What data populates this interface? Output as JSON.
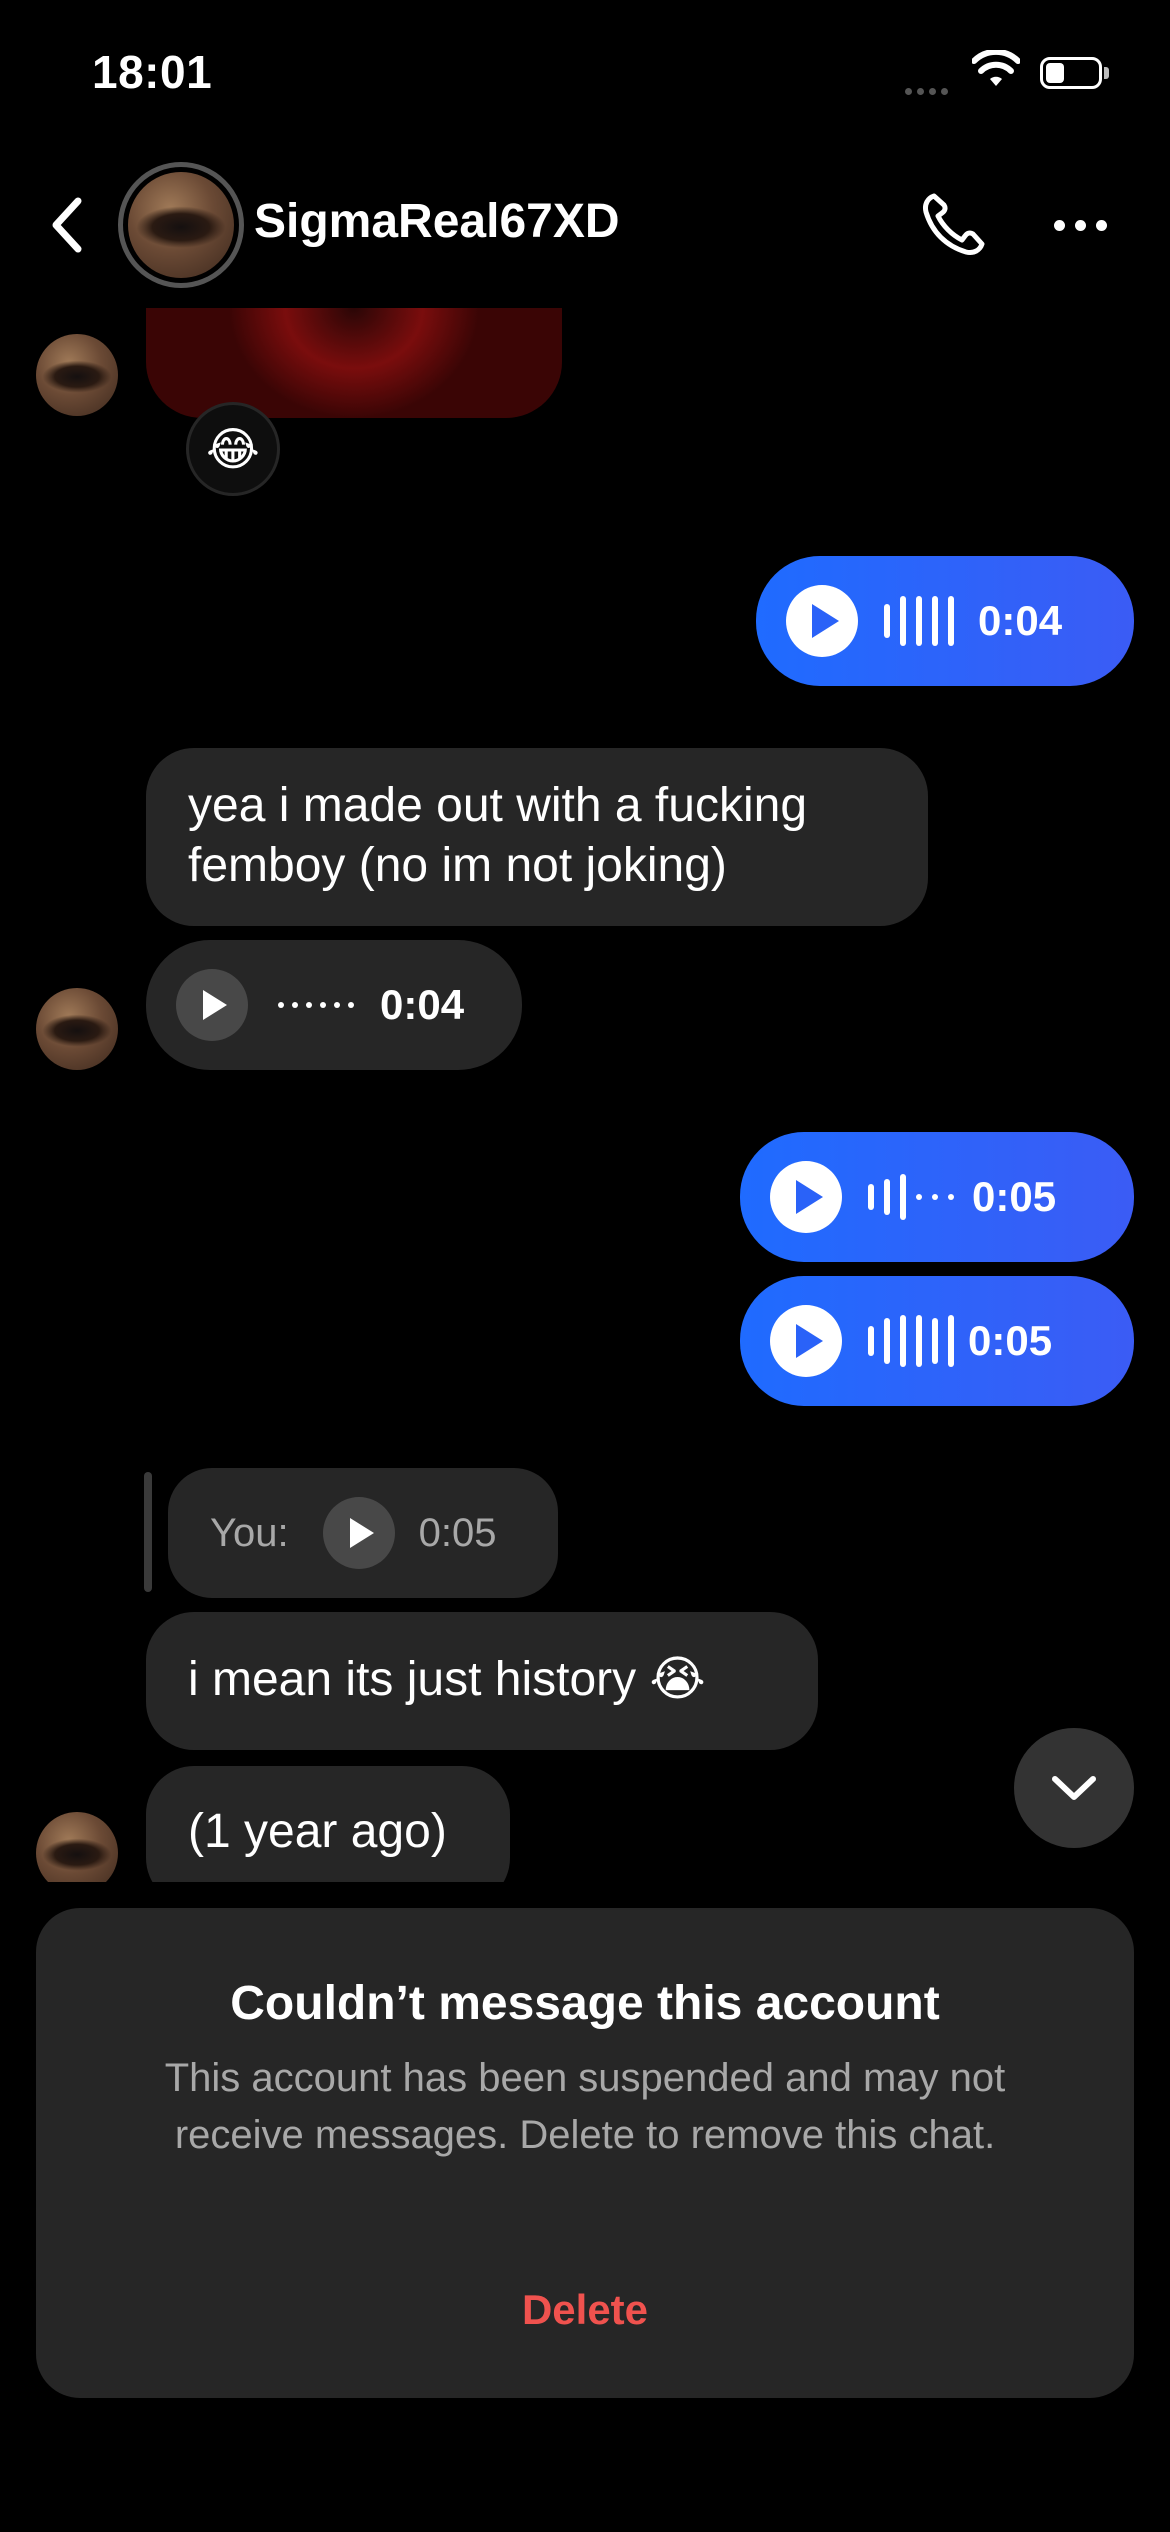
{
  "status_bar": {
    "time": "18:01"
  },
  "header": {
    "username": "SigmaReal67XD"
  },
  "messages": {
    "reaction_emoji": "😂",
    "out_voice_1_duration": "0:04",
    "in_text_1": "yea i made out with a fucking femboy (no im not joking)",
    "in_voice_1_duration": "0:04",
    "out_voice_2_duration": "0:05",
    "out_voice_3_duration": "0:05",
    "reply_label": "You:",
    "reply_duration": "0:05",
    "in_text_2": "i mean its just history 😭",
    "in_text_3": "(1 year ago)"
  },
  "notice": {
    "title": "Couldn’t message this account",
    "body": "This account has been suspended and may not receive messages. Delete to remove this chat.",
    "delete_label": "Delete"
  },
  "colors": {
    "accent_blue": "#2a62f8",
    "delete_red": "#f0524e",
    "bubble_gray": "#262626"
  }
}
